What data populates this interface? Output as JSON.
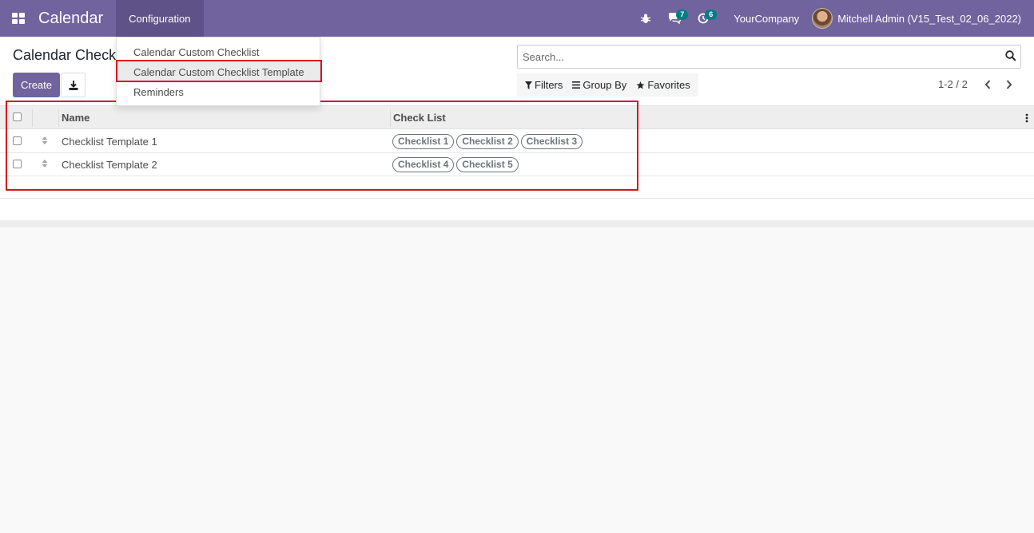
{
  "navbar": {
    "app_title": "Calendar",
    "menu_configuration": "Configuration",
    "messages_count": "7",
    "activities_count": "6",
    "company": "YourCompany",
    "user_name": "Mitchell Admin (V15_Test_02_06_2022)"
  },
  "dropdown": {
    "items": [
      {
        "label": "Calendar Custom Checklist"
      },
      {
        "label": "Calendar Custom Checklist Template"
      },
      {
        "label": "Reminders"
      }
    ]
  },
  "control_panel": {
    "page_title": "Calendar Check",
    "create_label": "Create",
    "search_placeholder": "Search...",
    "filters_label": "Filters",
    "group_by_label": "Group By",
    "favorites_label": "Favorites",
    "pager_value": "1-2 / 2"
  },
  "list": {
    "columns": {
      "name": "Name",
      "check_list": "Check List"
    },
    "rows": [
      {
        "name": "Checklist Template 1",
        "tags": [
          "Checklist 1",
          "Checklist 2",
          "Checklist 3"
        ]
      },
      {
        "name": "Checklist Template 2",
        "tags": [
          "Checklist 4",
          "Checklist 5"
        ]
      }
    ]
  },
  "colors": {
    "brand": "#71639e",
    "highlight": "#d9101d",
    "badge": "#017e84"
  }
}
